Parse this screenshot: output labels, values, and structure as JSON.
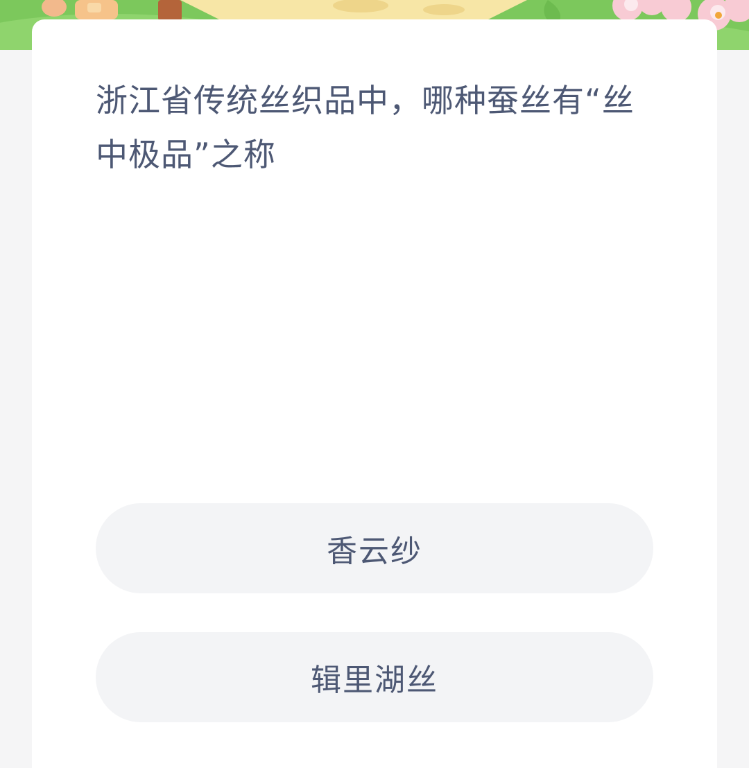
{
  "quiz": {
    "question": "浙江省传统丝织品中，哪种蚕丝有“丝中极品”之称",
    "options": [
      {
        "label": "香云纱"
      },
      {
        "label": "辑里湖丝"
      }
    ]
  },
  "banner": {
    "illustration": "cartoon-illustration",
    "colors": {
      "grass": "#7cc85c",
      "sand": "#f7e6a6",
      "flower": "#f7c9d2"
    }
  },
  "colors": {
    "page_background": "#f5f5f6",
    "card_background": "#ffffff",
    "text": "#4d5874",
    "option_background": "#f3f4f6"
  }
}
